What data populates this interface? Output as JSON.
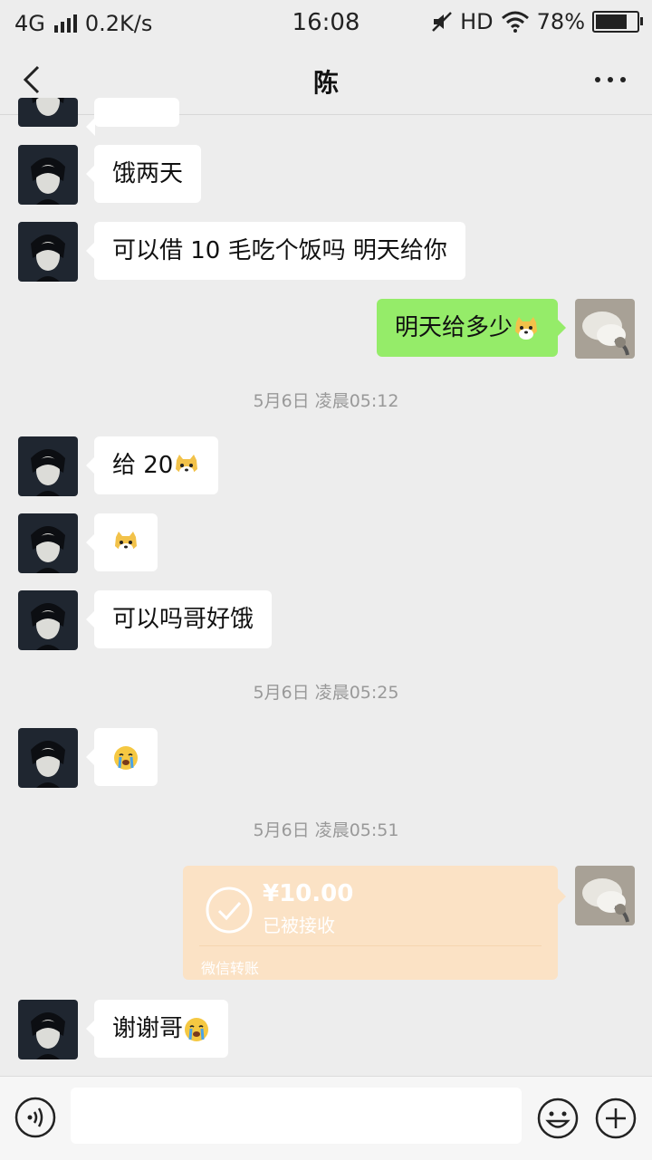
{
  "status": {
    "signal": "4G",
    "speed": "0.2K/s",
    "time": "16:08",
    "hd": "HD",
    "battery_text": "78%",
    "battery_level": 0.78
  },
  "header": {
    "title": "陈"
  },
  "messages": [
    {
      "text": "饿两天"
    },
    {
      "text": "可以借 10 毛吃个饭吗 明天给你"
    },
    {
      "text": "明天给多少"
    },
    {
      "text": "给 20"
    },
    {
      "text": ""
    },
    {
      "text": "可以吗哥好饿"
    },
    {
      "text": ""
    },
    {
      "text": "谢谢哥"
    }
  ],
  "timestamps": [
    "5月6日 凌晨05:12",
    "5月6日 凌晨05:25",
    "5月6日 凌晨05:51"
  ],
  "transfer": {
    "amount": "¥10.00",
    "status": "已被接收",
    "label": "微信转账"
  },
  "input": {
    "placeholder": ""
  },
  "colors": {
    "background": "#ededed",
    "sent_bubble": "#95ec69",
    "transfer": "#fbe2c5"
  }
}
